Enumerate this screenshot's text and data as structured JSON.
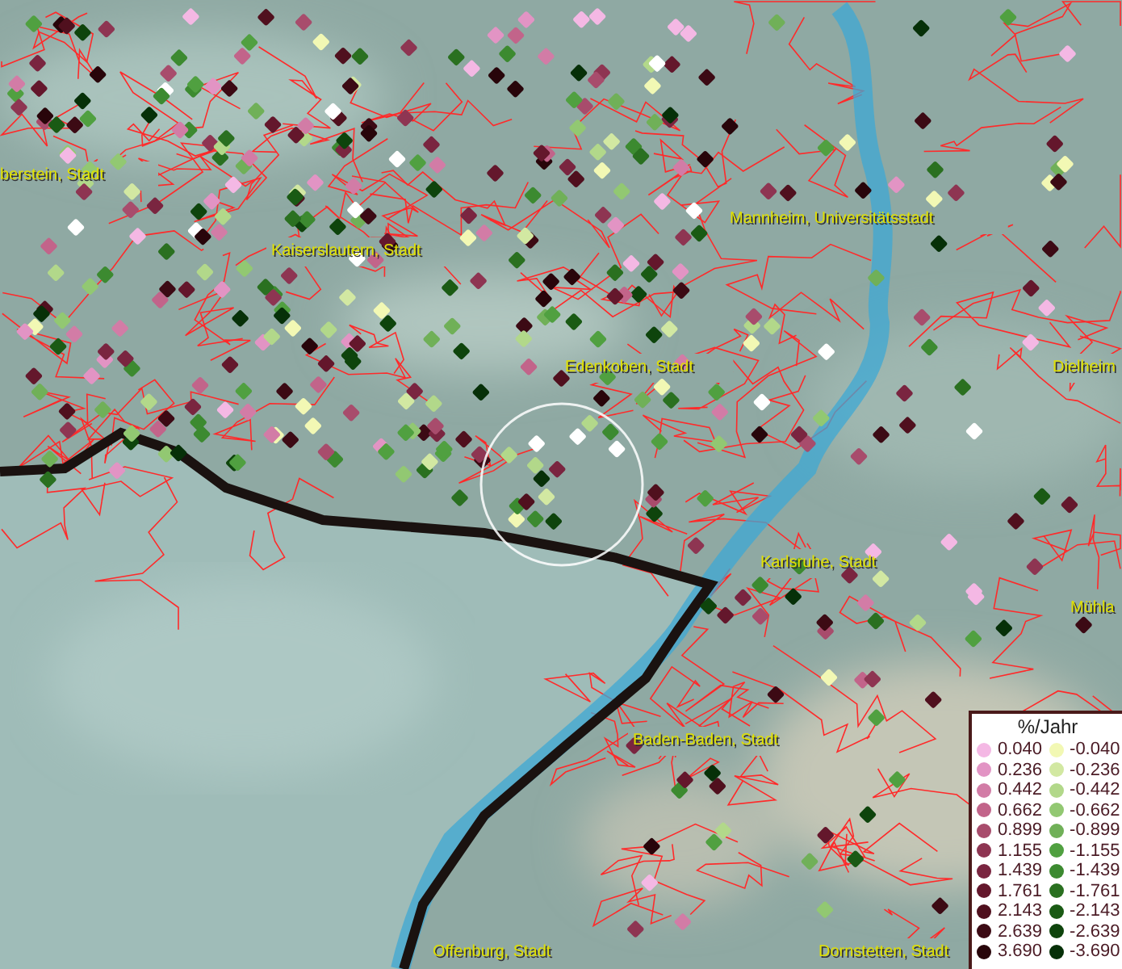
{
  "map": {
    "places": [
      {
        "name": "berstein, Stadt"
      },
      {
        "name": "Kaiserslautern, Stadt"
      },
      {
        "name": "Mannheim, Universitätsstadt"
      },
      {
        "name": "Edenkoben, Stadt"
      },
      {
        "name": "Dielheim"
      },
      {
        "name": "Karlsruhe, Stadt"
      },
      {
        "name": "Mühla"
      },
      {
        "name": "Baden-Baden, Stadt"
      },
      {
        "name": "Offenburg, Stadt"
      },
      {
        "name": "Dornstetten, Stadt"
      }
    ]
  },
  "legend": {
    "title": "%/Jahr",
    "positive": [
      {
        "value": "0.040",
        "color": "#f4b8e4"
      },
      {
        "value": "0.236",
        "color": "#e294c4"
      },
      {
        "value": "0.442",
        "color": "#d27ca6"
      },
      {
        "value": "0.662",
        "color": "#c2648a"
      },
      {
        "value": "0.899",
        "color": "#a84c6c"
      },
      {
        "value": "1.155",
        "color": "#8e3552"
      },
      {
        "value": "1.439",
        "color": "#7a2540"
      },
      {
        "value": "1.761",
        "color": "#64172c"
      },
      {
        "value": "2.143",
        "color": "#50101e"
      },
      {
        "value": "2.639",
        "color": "#3c0a14"
      },
      {
        "value": "3.690",
        "color": "#28050a"
      }
    ],
    "negative": [
      {
        "value": "-0.040",
        "color": "#f2f8b4"
      },
      {
        "value": "-0.236",
        "color": "#d2e8a2"
      },
      {
        "value": "-0.442",
        "color": "#b2d88a"
      },
      {
        "value": "-0.662",
        "color": "#92c872"
      },
      {
        "value": "-0.899",
        "color": "#70b058"
      },
      {
        "value": "-1.155",
        "color": "#50a040"
      },
      {
        "value": "-1.439",
        "color": "#3c8a30"
      },
      {
        "value": "-1.761",
        "color": "#2a7020"
      },
      {
        "value": "-2.143",
        "color": "#1a5a14"
      },
      {
        "value": "-2.639",
        "color": "#0e440c"
      },
      {
        "value": "-3.690",
        "color": "#063008"
      }
    ]
  }
}
